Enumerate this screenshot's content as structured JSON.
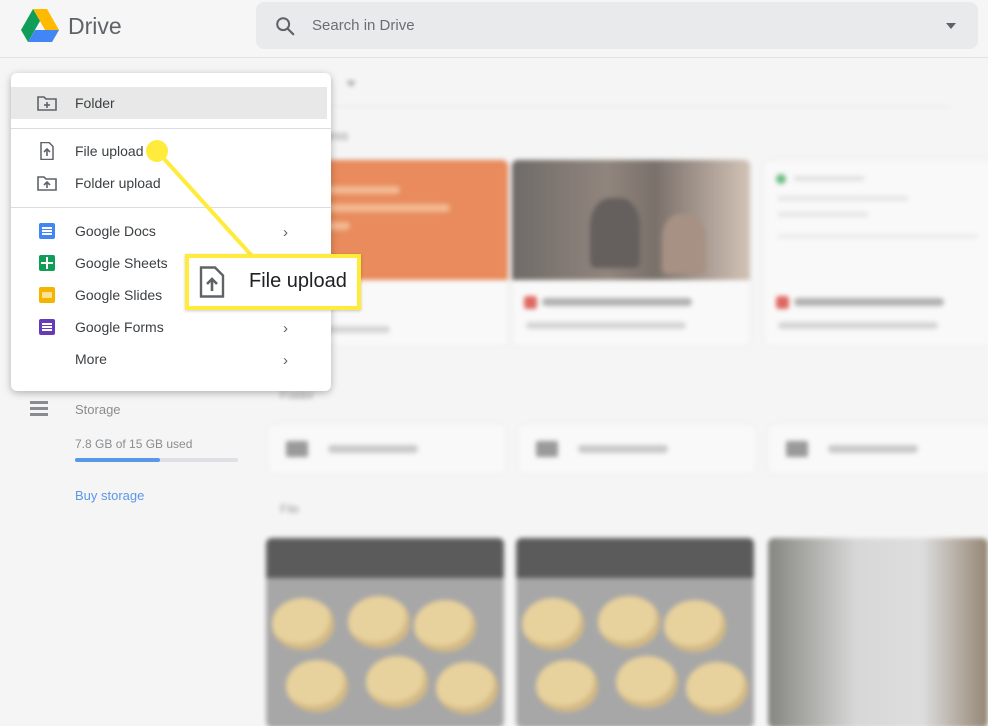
{
  "header": {
    "app_name": "Drive",
    "search_placeholder": "Search in Drive"
  },
  "main": {
    "title_fragment": "e",
    "section_access": "ess",
    "section_folders": "Folder",
    "section_files": "File",
    "colors": {
      "orange_card": "#e8621f",
      "accent": "#1a73e8"
    }
  },
  "new_menu": {
    "items": [
      {
        "label": "Folder",
        "icon": "new-folder-icon"
      },
      {
        "label": "File upload",
        "icon": "file-upload-icon"
      },
      {
        "label": "Folder upload",
        "icon": "folder-upload-icon"
      },
      {
        "label": "Google Docs",
        "icon": "google-docs-icon",
        "color": "#4285f4"
      },
      {
        "label": "Google Sheets",
        "icon": "google-sheets-icon",
        "color": "#0f9d58"
      },
      {
        "label": "Google Slides",
        "icon": "google-slides-icon",
        "color": "#f4b400"
      },
      {
        "label": "Google Forms",
        "icon": "google-forms-icon",
        "color": "#673ab7"
      },
      {
        "label": "More"
      }
    ]
  },
  "sidebar": {
    "storage_label": "Storage",
    "storage_used": "7.8 GB of 15 GB used",
    "storage_fraction": 0.52,
    "buy_storage": "Buy storage"
  },
  "callout": {
    "label": "File upload",
    "color": "#ffeb3b"
  }
}
